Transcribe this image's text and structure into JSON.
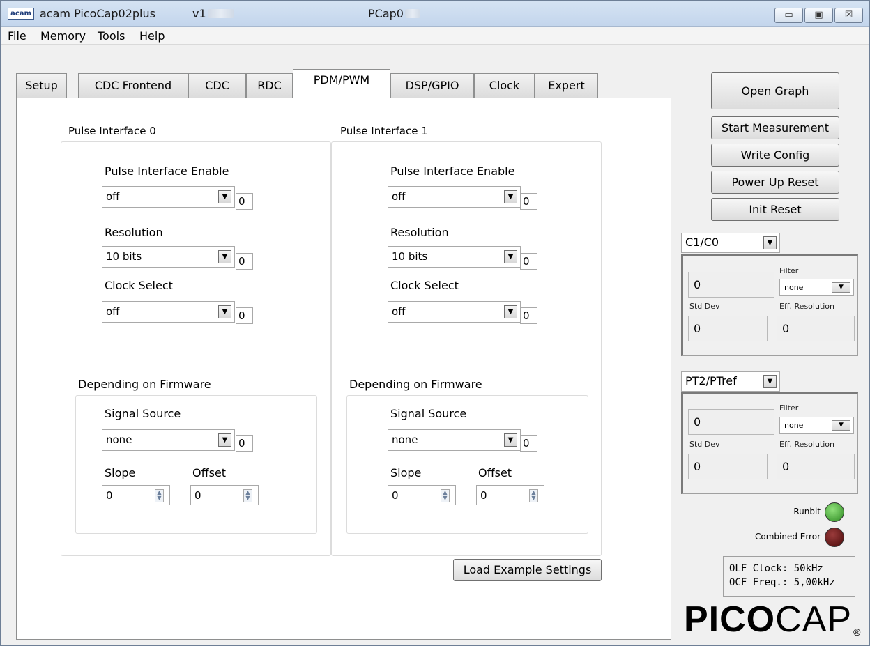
{
  "window": {
    "app_name": "acam PicoCap02plus",
    "version": "v1",
    "chip": "PCap0",
    "icon_text": "acam",
    "controls": {
      "minimize": "▭",
      "maximize": "▣",
      "close": "☒"
    }
  },
  "menu": {
    "items": [
      "File",
      "Memory",
      "Tools",
      "Help"
    ]
  },
  "tabs": [
    "Setup",
    "CDC Frontend",
    "CDC",
    "RDC",
    "PDM/PWM",
    "DSP/GPIO",
    "Clock",
    "Expert"
  ],
  "active_tab": "PDM/PWM",
  "pulse_interfaces": [
    {
      "title": "Pulse Interface 0",
      "enable": {
        "label": "Pulse Interface Enable",
        "value": "off",
        "reg": "0"
      },
      "resolution": {
        "label": "Resolution",
        "value": "10 bits",
        "reg": "0"
      },
      "clock_select": {
        "label": "Clock Select",
        "value": "off",
        "reg": "0"
      },
      "firmware": {
        "title": "Depending on Firmware",
        "signal_source": {
          "label": "Signal Source",
          "value": "none",
          "reg": "0"
        },
        "slope": {
          "label": "Slope",
          "value": "0"
        },
        "offset": {
          "label": "Offset",
          "value": "0"
        }
      }
    },
    {
      "title": "Pulse Interface 1",
      "enable": {
        "label": "Pulse Interface Enable",
        "value": "off",
        "reg": "0"
      },
      "resolution": {
        "label": "Resolution",
        "value": "10 bits",
        "reg": "0"
      },
      "clock_select": {
        "label": "Clock Select",
        "value": "off",
        "reg": "0"
      },
      "firmware": {
        "title": "Depending on Firmware",
        "signal_source": {
          "label": "Signal Source",
          "value": "none",
          "reg": "0"
        },
        "slope": {
          "label": "Slope",
          "value": "0"
        },
        "offset": {
          "label": "Offset",
          "value": "0"
        }
      }
    }
  ],
  "load_example_label": "Load Example Settings",
  "side_buttons": {
    "open_graph": "Open Graph",
    "start_measurement": "Start Measurement",
    "write_config": "Write Config",
    "power_up_reset": "Power Up Reset",
    "init_reset": "Init Reset"
  },
  "result_panels": [
    {
      "channel": "C1/C0",
      "value": "0",
      "filter_label": "Filter",
      "filter": "none",
      "std_dev_label": "Std Dev",
      "std_dev": "0",
      "eff_res_label": "Eff. Resolution",
      "eff_res": "0"
    },
    {
      "channel": "PT2/PTref",
      "value": "0",
      "filter_label": "Filter",
      "filter": "none",
      "std_dev_label": "Std Dev",
      "std_dev": "0",
      "eff_res_label": "Eff. Resolution",
      "eff_res": "0"
    }
  ],
  "indicators": {
    "runbit": {
      "label": "Runbit",
      "color": "#2e8b22"
    },
    "combined_error": {
      "label": "Combined Error",
      "color": "#4a0a0a"
    }
  },
  "status": {
    "olf_clock": "OLF Clock: 50kHz",
    "ocf_freq": "OCF Freq.: 5,00kHz"
  },
  "logo": {
    "bold": "PICO",
    "light": "CAP",
    "reg": "®"
  },
  "icons": {
    "dropdown": "▼",
    "spin_up": "▲",
    "spin_down": "▼"
  }
}
